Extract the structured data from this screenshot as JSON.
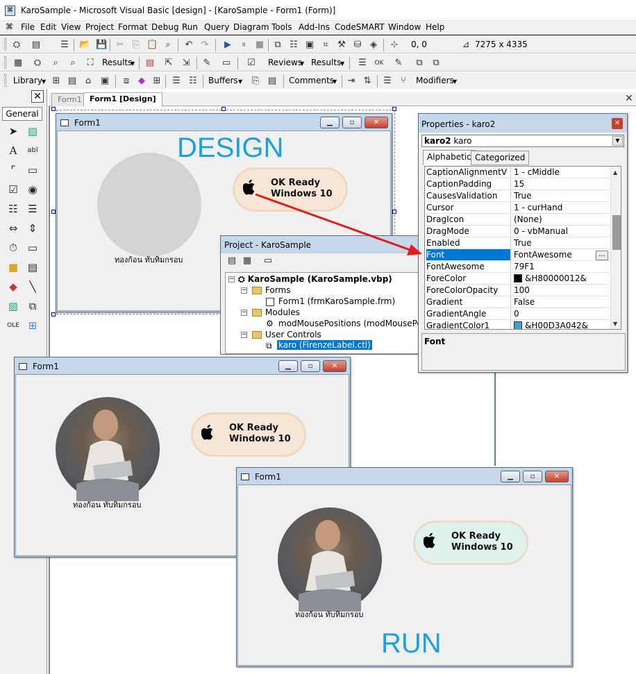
{
  "app": {
    "title": "KaroSample - Microsoft Visual Basic [design] - [KaroSample - Form1 (Form)]"
  },
  "menu": [
    "File",
    "Edit",
    "View",
    "Project",
    "Format",
    "Debug",
    "Run",
    "Query",
    "Diagram",
    "Tools",
    "Add-Ins",
    "CodeSMART",
    "Window",
    "Help"
  ],
  "toolbar1": {
    "coords": "0, 0",
    "size": "7275 x 4335"
  },
  "toolbar2": {
    "results1": "Results",
    "reviews": "Reviews",
    "results2": "Results"
  },
  "toolbar3": {
    "library": "Library",
    "buffers": "Buffers",
    "comments": "Comments",
    "modifiers": "Modifiers"
  },
  "toolbox": {
    "close": "✕",
    "section": "General"
  },
  "tabs": [
    "Form1",
    "Form1 [Design]"
  ],
  "design_form": {
    "caption": "Form1",
    "big_label": "DESIGN",
    "pill_line1": "OK Ready",
    "pill_line2": "Windows 10",
    "name_label": "ทองก้อน ทับทิมกรอบ"
  },
  "run_form_a": {
    "caption": "Form1",
    "pill_line1": "OK Ready",
    "pill_line2": "Windows 10",
    "name_label": "ทองก้อน ทับทิมกรอบ"
  },
  "run_form_b": {
    "caption": "Form1",
    "pill_line1": "OK Ready",
    "pill_line2": "Windows 10",
    "name_label": "ทองก้อน ทับทิมกรอบ",
    "big_label": "RUN"
  },
  "project": {
    "caption": "Project - KaroSample",
    "root": "KaroSample (KaroSample.vbp)",
    "forms": "Forms",
    "form1": "Form1 (frmKaroSample.frm)",
    "modules": "Modules",
    "module1": "modMousePositions (modMousePositions.bas)",
    "usercontrols": "User Controls",
    "karo": "karo (FirenzeLabel.ctl)"
  },
  "properties": {
    "caption": "Properties - karo2",
    "object_bold": "karo2",
    "object_type": "karo",
    "tab_alpha": "Alphabetic",
    "tab_cat": "Categorized",
    "rows": [
      {
        "name": "CaptionAlignmentV",
        "value": "1 - cMiddle"
      },
      {
        "name": "CaptionPadding",
        "value": "15"
      },
      {
        "name": "CausesValidation",
        "value": "True"
      },
      {
        "name": "Cursor",
        "value": "1 - curHand"
      },
      {
        "name": "DragIcon",
        "value": "(None)"
      },
      {
        "name": "DragMode",
        "value": "0 - vbManual"
      },
      {
        "name": "Enabled",
        "value": "True"
      },
      {
        "name": "Font",
        "value": "FontAwesome"
      },
      {
        "name": "FontAwesome",
        "value": "79F1"
      },
      {
        "name": "ForeColor",
        "value": "&H80000012&"
      },
      {
        "name": "ForeColorOpacity",
        "value": "100"
      },
      {
        "name": "Gradient",
        "value": "False"
      },
      {
        "name": "GradientAngle",
        "value": "0"
      },
      {
        "name": "GradientColor1",
        "value": "&H00D3A042&"
      }
    ],
    "desc_title": "Font",
    "ellipsis": "..."
  },
  "colors": {
    "accent": "#1ba1e2",
    "selection": "#0078d7",
    "pill_peach": "#f5e6d8",
    "pill_mint": "#dff2ee",
    "arrow": "#e21b1b"
  }
}
